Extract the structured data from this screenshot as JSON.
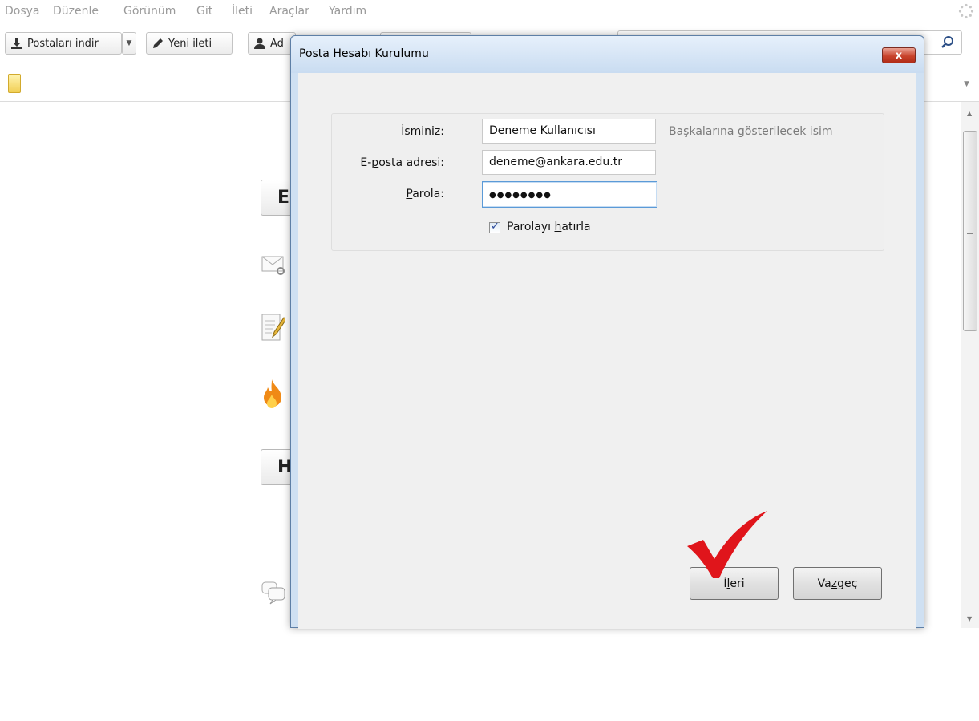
{
  "menu": {
    "items": [
      "Dosya",
      "Düzenle",
      "Görünüm",
      "Git",
      "İleti",
      "Araçlar",
      "Yardım"
    ]
  },
  "toolbar": {
    "get_mail_label": "Postaları indir",
    "new_message_label": "Yeni ileti",
    "address_book_partial": "Ad",
    "search_placeholder": ""
  },
  "start_page": {
    "button1_partial": "E",
    "button2_partial": "H"
  },
  "dialog": {
    "title": "Posta Hesabı Kurulumu",
    "close_symbol": "x",
    "name_label_pre": "İs",
    "name_label_u": "m",
    "name_label_post": "iniz:",
    "name_value": "Deneme Kullanıcısı",
    "name_hint": "Başkalarına gösterilecek isim",
    "email_label_pre": "E-",
    "email_label_u": "p",
    "email_label_post": "osta adresi:",
    "email_value": "deneme@ankara.edu.tr",
    "password_label_u": "P",
    "password_label_post": "arola:",
    "password_mask": "●●●●●●●●",
    "remember_checked": true,
    "remember_label_pre": "Parolayı ",
    "remember_label_u": "h",
    "remember_label_post": "atırla",
    "next_button_pre": "İ",
    "next_button_u": "l",
    "next_button_post": "eri",
    "cancel_button_pre": "Va",
    "cancel_button_u": "z",
    "cancel_button_post": "geç"
  },
  "colors": {
    "dialog_frame": "#cfe0f2",
    "close_button": "#c8432c",
    "annotation_check": "#e0151b"
  }
}
